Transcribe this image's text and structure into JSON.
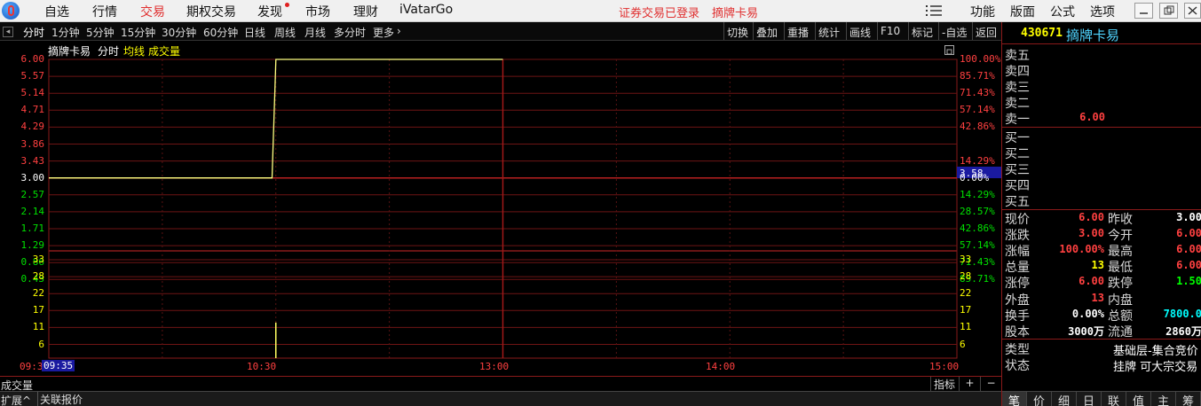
{
  "menu": {
    "items": [
      "自选",
      "行情",
      "交易",
      "期权交易",
      "发现",
      "市场",
      "理财",
      "iVatarGo"
    ],
    "active": "交易",
    "status": "证券交易已登录",
    "stock_name": "摘牌卡易",
    "right_items": [
      "功能",
      "版面",
      "公式",
      "选项"
    ]
  },
  "toolbar": {
    "periods": [
      "分时",
      "1分钟",
      "5分钟",
      "15分钟",
      "30分钟",
      "60分钟",
      "日线",
      "周线",
      "月线",
      "多分时",
      "更多"
    ],
    "tools": [
      "切换",
      "叠加",
      "重播",
      "统计",
      "画线",
      "F10",
      "标记",
      "-自选",
      "返回"
    ]
  },
  "chart": {
    "title": "摘牌卡易",
    "mode": "分时",
    "avg_label": "均线",
    "vol_label": "成交量",
    "price_ticks": [
      "6.00",
      "5.57",
      "5.14",
      "4.71",
      "4.29",
      "3.86",
      "3.43",
      "3.00",
      "2.57",
      "2.14",
      "1.71",
      "1.29",
      "0.86",
      "0.43"
    ],
    "pct_ticks": [
      "100.00%",
      "85.71%",
      "71.43%",
      "57.14%",
      "42.86%",
      "14.29%",
      "0.00%",
      "14.29%",
      "28.57%",
      "42.86%",
      "57.14%",
      "71.43%",
      "85.71%"
    ],
    "cursor_price": "3.58",
    "volume_ticks": [
      "33",
      "28",
      "22",
      "17",
      "11",
      "6"
    ],
    "time_ticks": [
      "09:3",
      "10:30",
      "13:00",
      "14:00",
      "15:00"
    ],
    "cursor_time": "09:35"
  },
  "chart_data": {
    "type": "line",
    "title": "摘牌卡易",
    "x": [
      "09:30",
      "10:29",
      "10:30",
      "11:30"
    ],
    "series": [
      {
        "values": [
          3.0,
          3.0,
          6.0,
          6.0
        ]
      }
    ],
    "ylim": [
      0.43,
      6.0
    ],
    "volume": {
      "x": [
        "10:30"
      ],
      "values": [
        13
      ],
      "ylim": [
        0,
        36
      ]
    },
    "prev_close": 3.0
  },
  "bottom": {
    "volume_label": "成交量",
    "indicator": "指标",
    "plus": "+",
    "minus": "−",
    "expand": "扩展^",
    "related": "关联报价"
  },
  "panel": {
    "code": "430671",
    "name": "摘牌卡易",
    "asks": [
      "卖五",
      "卖四",
      "卖三",
      "卖二",
      "卖一"
    ],
    "ask1_price": "6.00",
    "bids": [
      "买一",
      "买二",
      "买三",
      "买四",
      "买五"
    ],
    "stats": [
      {
        "l1": "现价",
        "v1": "6.00",
        "c1": "#ff4040",
        "l2": "昨收",
        "v2": "3.00",
        "c2": "#ffffff"
      },
      {
        "l1": "涨跌",
        "v1": "3.00",
        "c1": "#ff4040",
        "l2": "今开",
        "v2": "6.00",
        "c2": "#ff4040"
      },
      {
        "l1": "涨幅",
        "v1": "100.00%",
        "c1": "#ff4040",
        "l2": "最高",
        "v2": "6.00",
        "c2": "#ff4040"
      },
      {
        "l1": "总量",
        "v1": "13",
        "c1": "#ffff00",
        "l2": "最低",
        "v2": "6.00",
        "c2": "#ff4040"
      },
      {
        "l1": "涨停",
        "v1": "6.00",
        "c1": "#ff4040",
        "l2": "跌停",
        "v2": "1.50",
        "c2": "#00ff00"
      },
      {
        "l1": "外盘",
        "v1": "13",
        "c1": "#ff4040",
        "l2": "内盘",
        "v2": "",
        "c2": "#ffffff"
      },
      {
        "l1": "换手",
        "v1": "0.00%",
        "c1": "#ffffff",
        "l2": "总额",
        "v2": "7800.0",
        "c2": "#00ffff"
      },
      {
        "l1": "股本",
        "v1": "3000万",
        "c1": "#ffffff",
        "l2": "流通",
        "v2": "2860万",
        "c2": "#ffffff"
      }
    ],
    "type_label": "类型",
    "type_value": "基础层-集合竞价",
    "state_label": "状态",
    "state_value": "挂牌  可大宗交易",
    "tabs": [
      "笔",
      "价",
      "细",
      "日",
      "联",
      "值",
      "主",
      "筹"
    ]
  }
}
